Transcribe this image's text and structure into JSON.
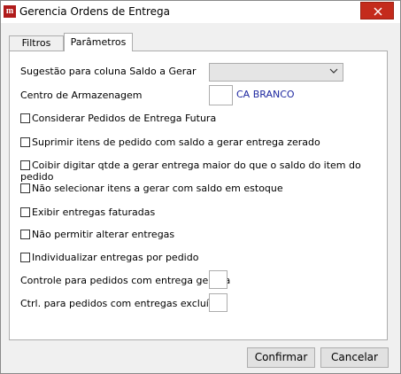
{
  "window": {
    "title": "Gerencia Ordens de Entrega",
    "icon": "app-logo-icon"
  },
  "tabs": [
    {
      "label": "Filtros",
      "active": false
    },
    {
      "label": "Parâmetros",
      "active": true
    }
  ],
  "parametros": {
    "sugestao_label": "Sugestão para coluna Saldo a Gerar",
    "sugestao_value": "",
    "centro_label": "Centro de Armazenagem",
    "centro_value": "",
    "centro_desc": "CA BRANCO",
    "checkboxes": [
      {
        "label": "Considerar Pedidos de Entrega Futura",
        "checked": false
      },
      {
        "label": "Suprimir itens de pedido com saldo a gerar entrega zerado",
        "checked": false
      },
      {
        "label": "Coibir digitar qtde a gerar entrega maior do que o saldo do item do pedido",
        "checked": false
      },
      {
        "label": "Não selecionar itens a gerar com saldo em estoque",
        "checked": false
      },
      {
        "label": "Exibir entregas faturadas",
        "checked": false
      },
      {
        "label": "Não permitir alterar entregas",
        "checked": false
      },
      {
        "label": "Individualizar entregas por pedido",
        "checked": false
      }
    ],
    "controle_label": "Controle para pedidos com entrega gerada",
    "controle_value": "",
    "ctrl_excluidas_label": "Ctrl. para pedidos com entregas excluídas",
    "ctrl_excluidas_value": ""
  },
  "buttons": {
    "confirmar": "Confirmar",
    "cancelar": "Cancelar"
  },
  "colors": {
    "close": "#c42b1c",
    "link_text": "#1e28a0",
    "panel": "#ffffff"
  }
}
